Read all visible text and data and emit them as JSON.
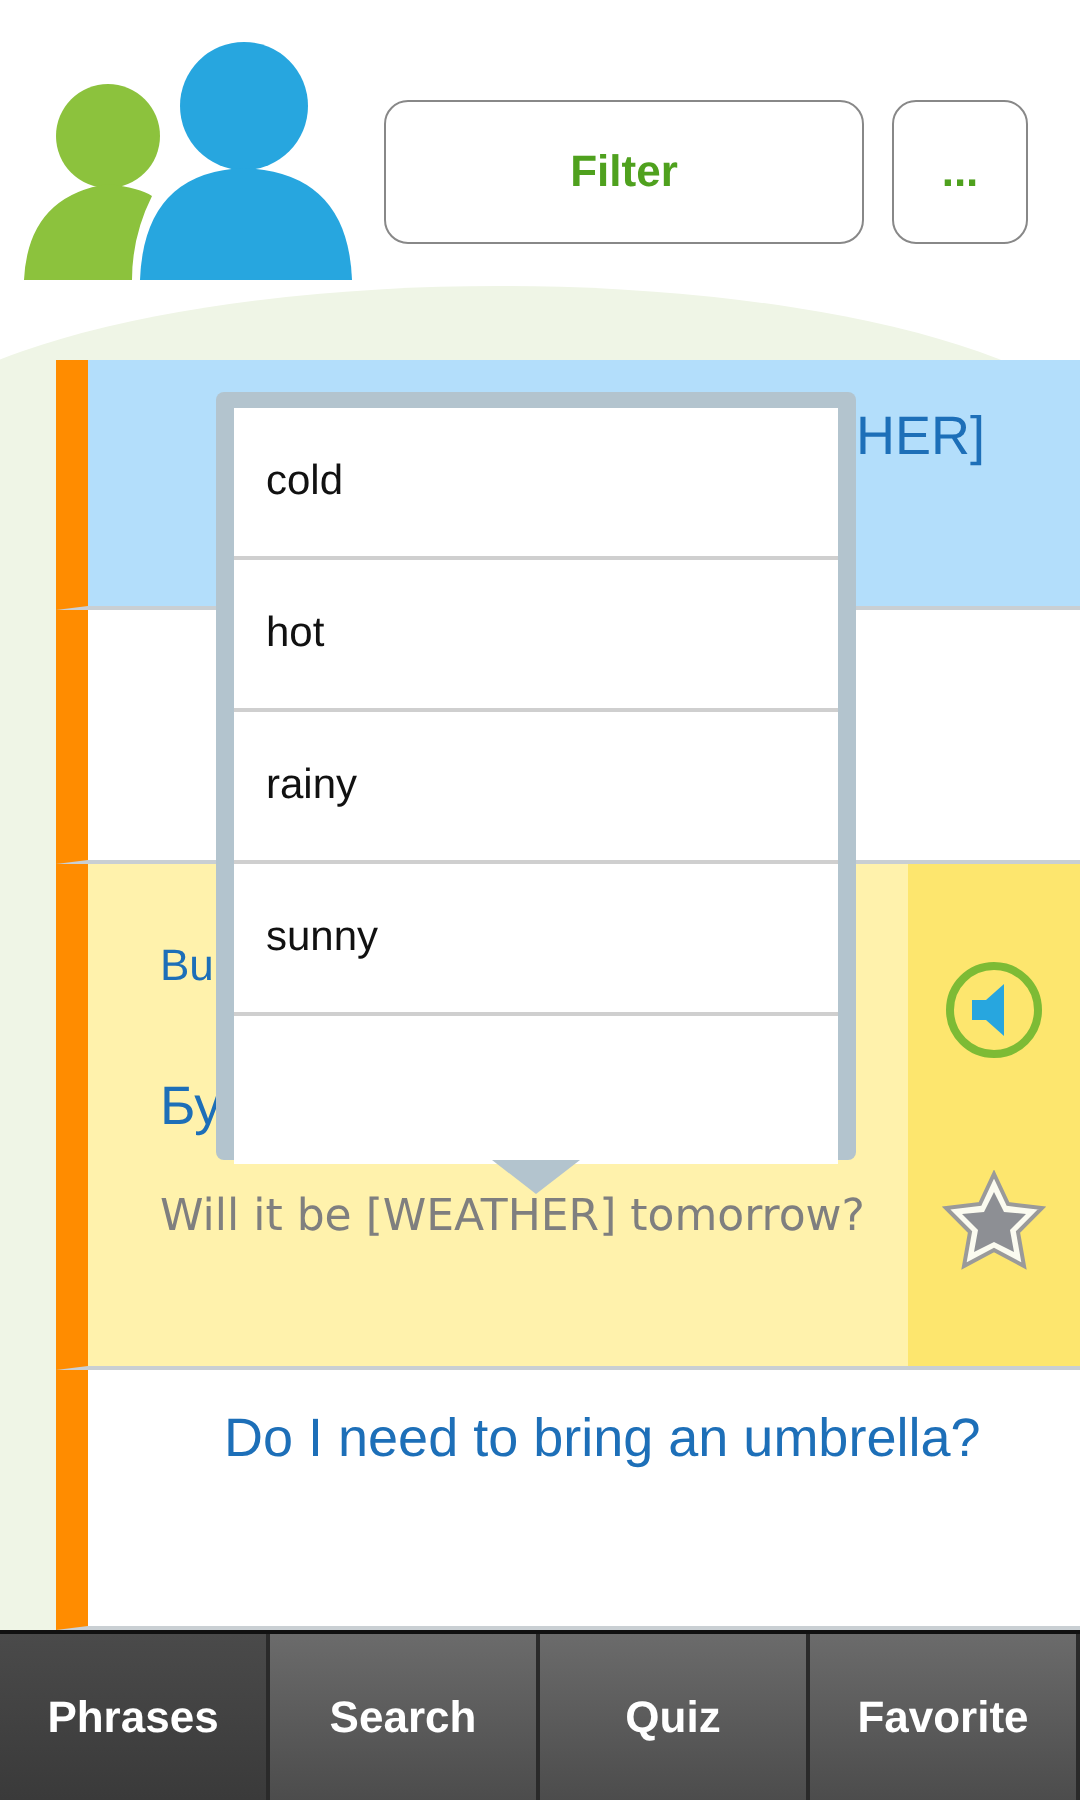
{
  "header": {
    "buttons": [
      {
        "label": "Filter"
      },
      {
        "label": "..."
      }
    ]
  },
  "phrases": [
    {
      "kind": "simple",
      "selected": true,
      "text": "HER]"
    },
    {
      "kind": "simple",
      "selected": false
    },
    {
      "kind": "expanded",
      "selected": false,
      "transliteration": "Bu",
      "native": "Бу",
      "translation": "Will it be [WEATHER] tomorrow?"
    },
    {
      "kind": "simple",
      "selected": false,
      "text": "Do I need to bring an umbrella?"
    }
  ],
  "popover": {
    "options": [
      "cold",
      "hot",
      "rainy",
      "sunny"
    ]
  },
  "tabs": [
    {
      "label": "Phrases",
      "selected": true
    },
    {
      "label": "Search",
      "selected": false
    },
    {
      "label": "Quiz",
      "selected": false
    },
    {
      "label": "Favorite",
      "selected": false
    }
  ]
}
